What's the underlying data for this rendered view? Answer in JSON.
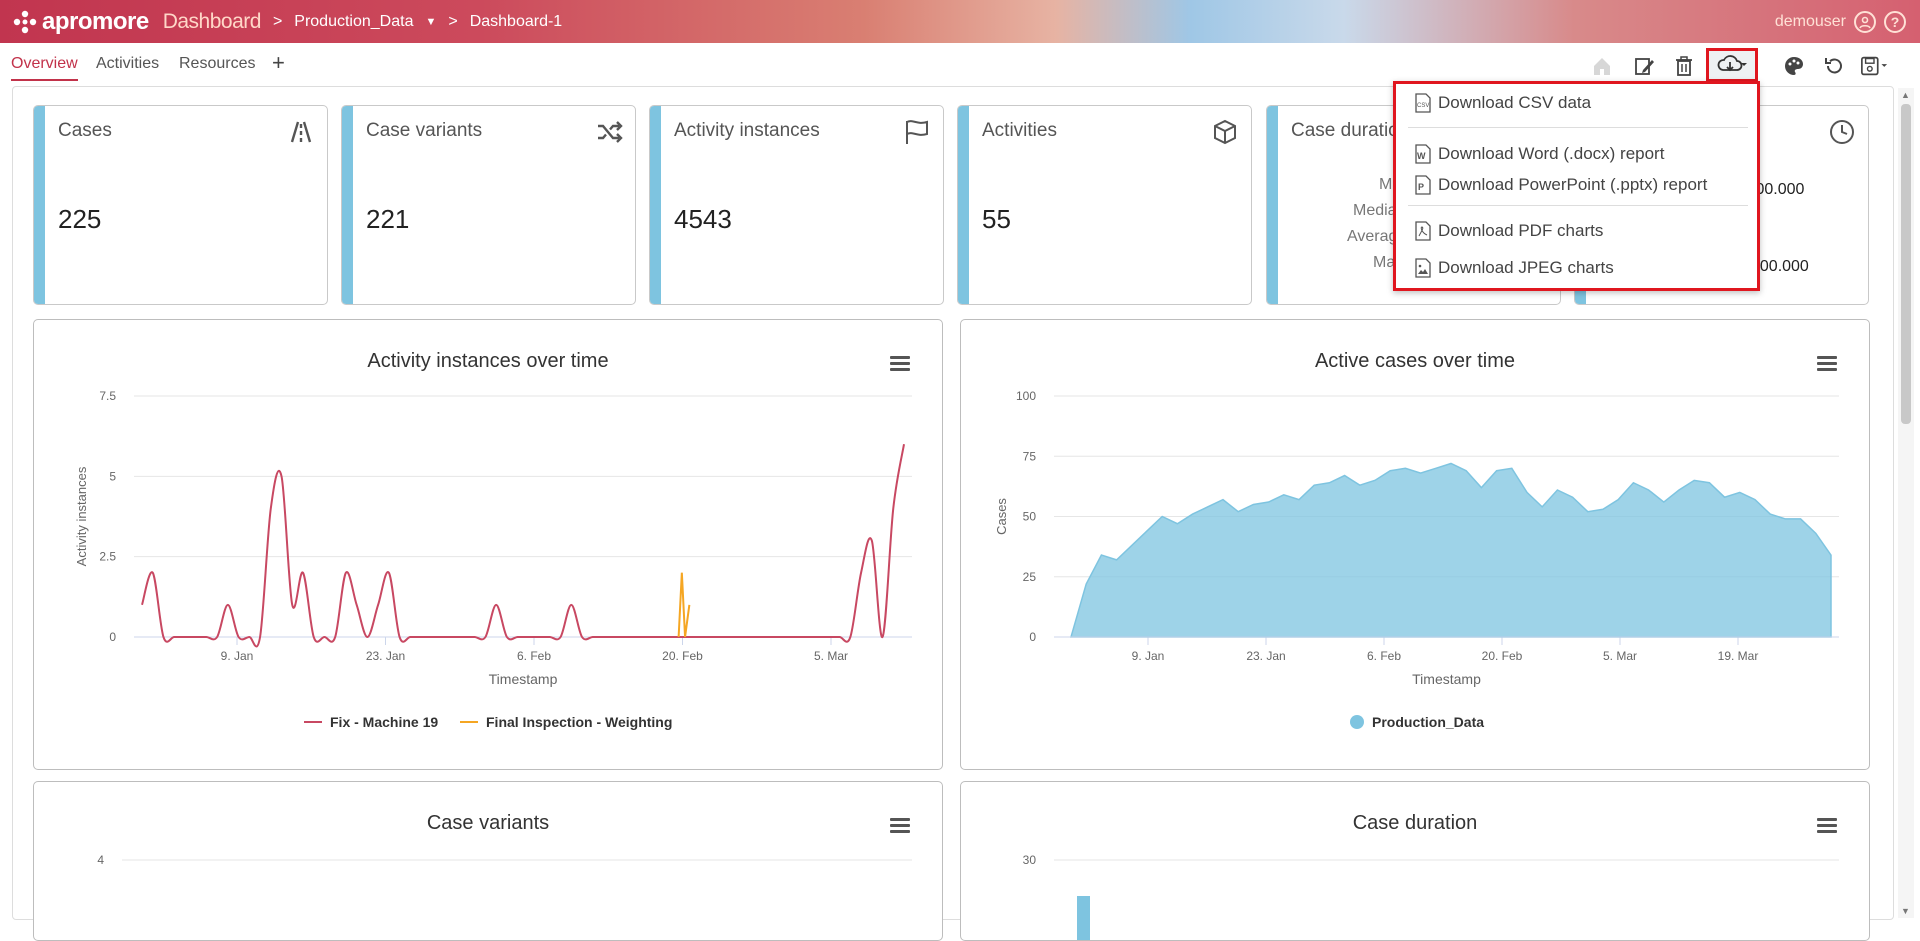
{
  "header": {
    "brand": "apromore",
    "section": "Dashboard",
    "separator": ">",
    "log_name": "Production_Data",
    "dashboard_name": "Dashboard-1",
    "user": "demouser",
    "help": "?"
  },
  "tabs": [
    {
      "label": "Overview",
      "active": true
    },
    {
      "label": "Activities",
      "active": false
    },
    {
      "label": "Resources",
      "active": false
    },
    {
      "label": "+",
      "active": false
    }
  ],
  "toolbar_icons": [
    "home-icon",
    "edit-icon",
    "delete-icon",
    "download-icon",
    "palette-icon",
    "refresh-icon",
    "save-icon"
  ],
  "download_menu": {
    "items": [
      {
        "label": "Download CSV data",
        "icon": "csv-file-icon"
      },
      {
        "label": "Download Word (.docx) report",
        "icon": "word-file-icon"
      },
      {
        "label": "Download PowerPoint (.pptx) report",
        "icon": "powerpoint-file-icon"
      },
      {
        "label": "Download PDF charts",
        "icon": "pdf-file-icon"
      },
      {
        "label": "Download JPEG charts",
        "icon": "image-file-icon"
      }
    ]
  },
  "cards": [
    {
      "title": "Cases",
      "value": "225",
      "icon": "road-icon"
    },
    {
      "title": "Case variants",
      "value": "221",
      "icon": "shuffle-icon"
    },
    {
      "title": "Activity instances",
      "value": "4543",
      "icon": "flag-icon"
    },
    {
      "title": "Activities",
      "value": "55",
      "icon": "cube-icon"
    },
    {
      "title": "Case duratio",
      "stats": [
        "M",
        "Media",
        "Averag",
        "Ma"
      ],
      "icon": ""
    },
    {
      "title": "",
      "stats": [
        ":00.000",
        "::00.000"
      ],
      "icon": "clock-icon"
    }
  ],
  "colors": {
    "accent": "#c2324a",
    "card_bar": "#7ec4e0",
    "series1": "#c84862",
    "series2": "#f5a623",
    "area": "#7ec4e0",
    "highlight": "#e0161f"
  },
  "chart_data": [
    {
      "type": "line",
      "title": "Activity instances over time",
      "xlabel": "Timestamp",
      "ylabel": "Activity instances",
      "ylim": [
        0,
        7.5
      ],
      "yticks": [
        "7.5",
        "5",
        "2.5",
        "0"
      ],
      "xticks": [
        "9. Jan",
        "23. Jan",
        "6. Feb",
        "20. Feb",
        "5. Mar"
      ],
      "series": [
        {
          "name": "Fix - Machine 19",
          "x": [
            0,
            1,
            2,
            3,
            4,
            5,
            6,
            7,
            8,
            9,
            10,
            11,
            12,
            13,
            14,
            15,
            16,
            17,
            18,
            19,
            20,
            21,
            22,
            23,
            24,
            25,
            26,
            27,
            28,
            29,
            30,
            31,
            32,
            33,
            34,
            35,
            36,
            37,
            38,
            39,
            40,
            41,
            42,
            43,
            44,
            45,
            46,
            47,
            48,
            49,
            50,
            51,
            52,
            53,
            54,
            55,
            56,
            57,
            58,
            59,
            60,
            61,
            62,
            63,
            64,
            65,
            66,
            67,
            68,
            69,
            70,
            71
          ],
          "values": [
            1,
            2,
            0,
            0,
            0,
            0,
            0,
            0,
            1,
            0,
            0,
            0,
            4,
            5,
            1,
            2,
            0,
            0,
            0,
            2,
            1,
            0,
            1,
            2,
            0,
            0,
            0,
            0,
            0,
            0,
            0,
            0,
            0,
            1,
            0,
            0,
            0,
            0,
            0,
            0,
            1,
            0,
            0,
            0,
            0,
            0,
            0,
            0,
            0,
            0,
            0,
            0,
            0,
            0,
            0,
            0,
            0,
            0,
            0,
            0,
            0,
            0,
            0,
            0,
            0,
            0,
            0,
            2,
            3,
            0,
            4,
            6
          ]
        },
        {
          "name": "Final Inspection - Weighting",
          "x": [
            50,
            50.3,
            50.6,
            51
          ],
          "values": [
            0,
            2,
            0,
            1
          ]
        }
      ],
      "legend": "bottom"
    },
    {
      "type": "area",
      "title": "Active cases over time",
      "xlabel": "Timestamp",
      "ylabel": "Cases",
      "ylim": [
        0,
        100
      ],
      "yticks": [
        "100",
        "75",
        "50",
        "25",
        "0"
      ],
      "xticks": [
        "9. Jan",
        "23. Jan",
        "6. Feb",
        "20. Feb",
        "5. Mar",
        "19. Mar"
      ],
      "series": [
        {
          "name": "Production_Data",
          "values": [
            0,
            22,
            34,
            32,
            38,
            44,
            50,
            47,
            51,
            54,
            57,
            52,
            55,
            56,
            59,
            57,
            63,
            64,
            67,
            63,
            65,
            69,
            70,
            68,
            70,
            72,
            69,
            62,
            69,
            70,
            60,
            54,
            61,
            58,
            52,
            53,
            57,
            64,
            61,
            56,
            61,
            65,
            64,
            58,
            60,
            57,
            51,
            49,
            49,
            43,
            34
          ]
        }
      ],
      "legend": "bottom"
    },
    {
      "type": "bar",
      "title": "Case variants",
      "yticks": [
        "4"
      ],
      "values": []
    },
    {
      "type": "bar",
      "title": "Case duration",
      "yticks": [
        "30"
      ],
      "values": []
    }
  ]
}
